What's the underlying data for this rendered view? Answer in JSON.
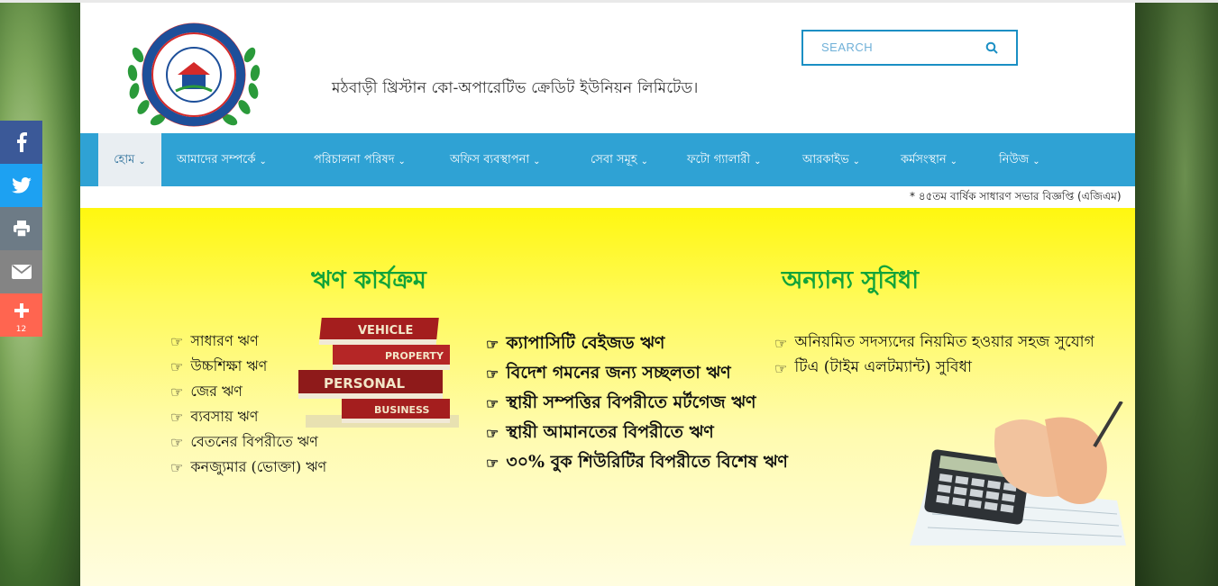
{
  "org": {
    "title": "মঠবাড়ী খ্রিস্টান কো-অপারেটিভ ক্রেডিট ইউনিয়ন লিমিটেড।"
  },
  "search": {
    "placeholder": "SEARCH"
  },
  "nav": {
    "items": [
      {
        "label": "হোম"
      },
      {
        "label": "আমাদের সম্পর্কে"
      },
      {
        "label": "পরিচালনা পরিষদ"
      },
      {
        "label": "অফিস ব্যবস্থাপনা"
      },
      {
        "label": "সেবা সমূহ"
      },
      {
        "label": "ফটো গ্যালারী"
      },
      {
        "label": "আরকাইভ"
      },
      {
        "label": "কর্মসংস্থান"
      },
      {
        "label": "নিউজ"
      }
    ]
  },
  "marquee": {
    "text": "* ৪৫তম বার্ষিক সাধারণ সভার বিজ্ঞপ্তি (এজিএম)"
  },
  "banner": {
    "loan_heading": "ঋণ কার্যক্রম",
    "other_heading": "অন্যান্য সুবিধা",
    "loans_col1": [
      "সাধারণ ঋণ",
      "উচ্চশিক্ষা ঋণ",
      "জের ঋণ",
      "ব্যবসায় ঋণ",
      "বেতনের বিপরীতে ঋণ",
      "কনজ্যুমার (ভোক্তা) ঋণ"
    ],
    "loans_col2": [
      "ক্যাপাসিটি বেইজড ঋণ",
      "বিদেশ গমনের জন্য সচ্ছলতা ঋণ",
      "স্থায়ী সম্পত্তির বিপরীতে মর্টগেজ ঋণ",
      "স্থায়ী আমানতের বিপরীতে ঋণ",
      "৩০% বুক শিউরিটির বিপরীতে বিশেষ ঋণ"
    ],
    "other_list": [
      "অনিয়মিত সদস্যদের নিয়মিত হওয়ার সহজ সুযোগ",
      "টিএ (টাইম এলটম্যান্ট) সুবিধা"
    ],
    "books": [
      "VEHICLE",
      "PROPERTY",
      "PERSONAL",
      "BUSINESS"
    ],
    "hand_icon": "☞"
  },
  "share": {
    "count": "12",
    "colors": {
      "facebook": "#3b5998",
      "twitter": "#1da1f2",
      "print": "#6d7b86",
      "email": "#848484",
      "more": "#ff6550"
    }
  },
  "colors": {
    "nav": "#2fa2d4",
    "heading": "#11a33a",
    "search_border": "#1a8fc4"
  }
}
